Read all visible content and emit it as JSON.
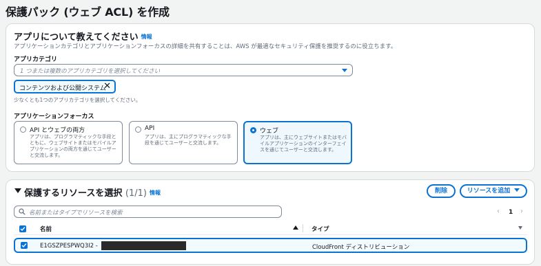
{
  "page": {
    "title": "保護パック (ウェブ ACL) を作成"
  },
  "app_section": {
    "title": "アプリについて教えてください",
    "info_link": "情報",
    "description": "アプリケーションカテゴリとアプリケーションフォーカスの詳細を共有することは、AWS が最適なセキュリティ保護を推奨するのに役立ちます。",
    "category": {
      "label": "アプリカテゴリ",
      "placeholder": "1 つまたは複数のアプリカテゴリを選択してください",
      "selected_token": "コンテンツおよび公開システム",
      "hint": "少なくとも1つのアプリカテゴリを選択してください。"
    },
    "focus": {
      "label": "アプリケーションフォーカス",
      "options": [
        {
          "title": "API とウェブの両方",
          "description": "アプリは、プログラマティックな手段とともに、ウェブサイトまたはモバイルアプリケーションの両方を通じてユーザーと交流します。",
          "selected": false
        },
        {
          "title": "API",
          "description": "アプリは、主にプログラマティックな手段を通じてユーザーと交流します。",
          "selected": false
        },
        {
          "title": "ウェブ",
          "description": "アプリは、主にウェブサイトまたはモバイルアプリケーションのインターフェイスを通じてユーザーと交流します。",
          "selected": true
        }
      ]
    }
  },
  "resources_section": {
    "title": "保護するリソースを選択",
    "count": "(1/1)",
    "info_link": "情報",
    "remove_button": "削除",
    "add_button": "リソースを追加",
    "search_placeholder": "名前またはタイプでリソースを検索",
    "pagination": {
      "current_page": "1"
    },
    "table": {
      "columns": [
        "名前",
        "タイプ"
      ],
      "rows": [
        {
          "name": "E1GSZPESPWQ3I2 -",
          "type": "CloudFront ディストリビューション",
          "checked": true
        }
      ]
    }
  },
  "colors": {
    "accent": "#0972d3",
    "text": "#16191f",
    "muted": "#5f6b7a",
    "border": "#d5dbdb"
  },
  "icons": [
    "caret-down-icon",
    "close-icon",
    "search-icon",
    "chevron-left-icon",
    "chevron-right-icon",
    "sort-ascending-icon",
    "sort-icon",
    "checkmark-icon"
  ]
}
